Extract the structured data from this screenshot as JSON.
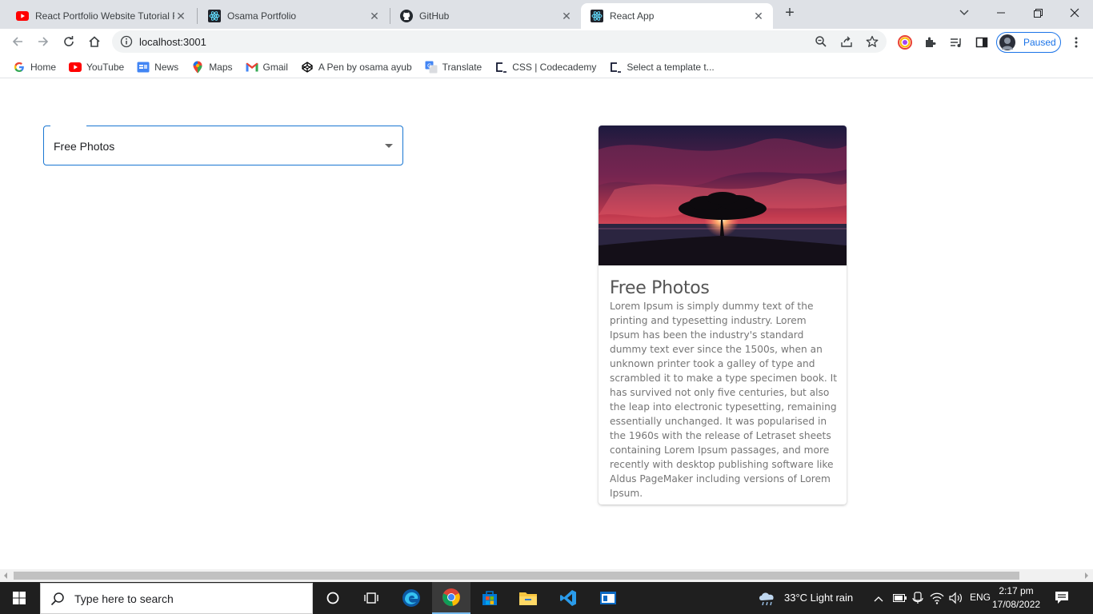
{
  "browser": {
    "tabs": [
      {
        "title": "React Portfolio Website Tutorial F",
        "icon": "youtube-icon",
        "active": false
      },
      {
        "title": "Osama Portfolio",
        "icon": "react-icon",
        "active": false
      },
      {
        "title": "GitHub",
        "icon": "github-icon",
        "active": false
      },
      {
        "title": "React App",
        "icon": "react-icon",
        "active": true
      }
    ],
    "url": "localhost:3001",
    "profile_status": "Paused",
    "bookmarks": [
      {
        "label": "Home",
        "icon": "google-icon"
      },
      {
        "label": "YouTube",
        "icon": "youtube-icon"
      },
      {
        "label": "News",
        "icon": "google-news-icon"
      },
      {
        "label": "Maps",
        "icon": "maps-pin-icon"
      },
      {
        "label": "Gmail",
        "icon": "gmail-icon"
      },
      {
        "label": "A Pen by osama ayub",
        "icon": "codepen-icon"
      },
      {
        "label": "Translate",
        "icon": "translate-icon"
      },
      {
        "label": "CSS | Codecademy",
        "icon": "codecademy-icon"
      },
      {
        "label": "Select a template t...",
        "icon": "codecademy-icon"
      }
    ]
  },
  "page": {
    "select": {
      "value": "Free Photos"
    },
    "card": {
      "title": "Free Photos",
      "image": "tree-at-sunset-image",
      "body": "Lorem Ipsum is simply dummy text of the printing and typesetting industry. Lorem Ipsum has been the industry's standard dummy text ever since the 1500s, when an unknown printer took a galley of type and scrambled it to make a type specimen book. It has survived not only five centuries, but also the leap into electronic typesetting, remaining essentially unchanged. It was popularised in the 1960s with the release of Letraset sheets containing Lorem Ipsum passages, and more recently with desktop publishing software like Aldus PageMaker including versions of Lorem Ipsum."
    }
  },
  "taskbar": {
    "search_placeholder": "Type here to search",
    "weather": "33°C  Light rain",
    "language": "ENG",
    "time": "2:17 pm",
    "date": "17/08/2022"
  },
  "colors": {
    "accent": "#1976d2",
    "profile_accent": "#1a73e8",
    "tabstrip_bg": "#dee1e6",
    "taskbar_bg": "#1f1f1f"
  }
}
